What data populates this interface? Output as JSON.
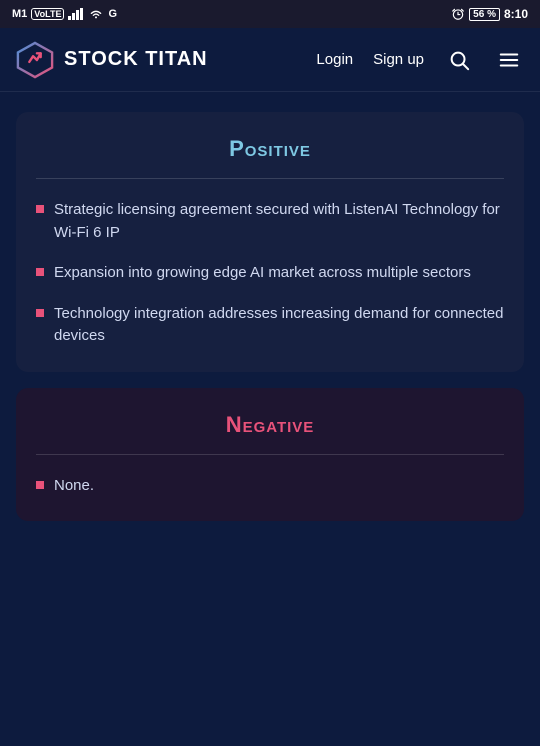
{
  "statusBar": {
    "carrier": "M1",
    "voLTE": "VoLTE",
    "time": "8:10",
    "battery": "56"
  },
  "navbar": {
    "logoText": "STOCK TITAN",
    "loginLabel": "Login",
    "signupLabel": "Sign up"
  },
  "positive": {
    "title": "Positive",
    "items": [
      "Strategic licensing agreement secured with ListenAI Technology for Wi-Fi 6 IP",
      "Expansion into growing edge AI market across multiple sectors",
      "Technology integration addresses increasing demand for connected devices"
    ]
  },
  "negative": {
    "title": "Negative",
    "items": [
      "None."
    ]
  }
}
